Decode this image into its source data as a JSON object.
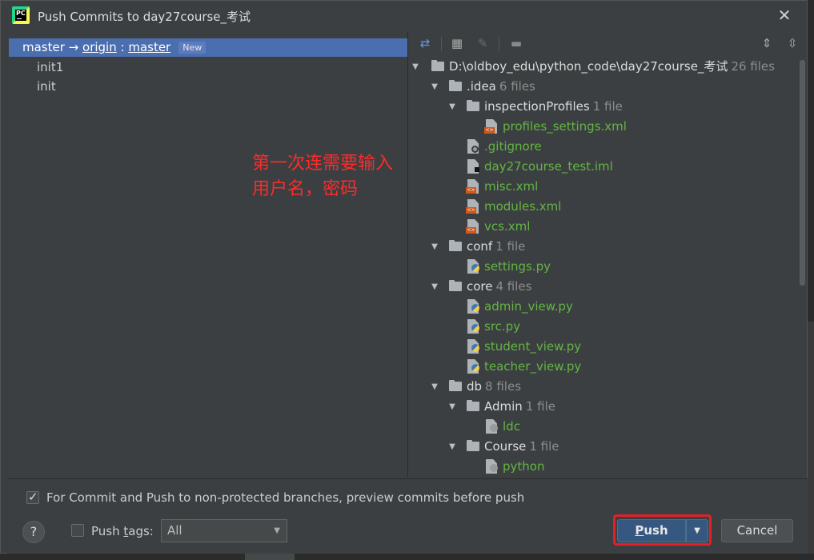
{
  "window": {
    "title": "Push Commits to day27course_考试",
    "app_icon": "pycharm-icon",
    "close_icon": "✕"
  },
  "left": {
    "branch": {
      "local": "master",
      "arrow": " → ",
      "remote": "origin",
      "sep": " : ",
      "remote_branch": "master",
      "badge": "New"
    },
    "commits": [
      "init1",
      "init"
    ]
  },
  "annotation": {
    "line1": "第一次连需要输入",
    "line2": "用户名，密码",
    "color": "#ff2a2a"
  },
  "tree": {
    "root": {
      "name": "D:\\oldboy_edu\\python_code\\day27course_考试",
      "count": "26 files"
    },
    "idea": {
      "name": ".idea",
      "count": "6 files"
    },
    "inspection": {
      "name": "inspectionProfiles",
      "count": "1 file"
    },
    "profiles": {
      "name": "profiles_settings.xml"
    },
    "gitignore": {
      "name": ".gitignore"
    },
    "iml": {
      "name": "day27course_test.iml"
    },
    "misc": {
      "name": "misc.xml"
    },
    "modules": {
      "name": "modules.xml"
    },
    "vcs": {
      "name": "vcs.xml"
    },
    "conf": {
      "name": "conf",
      "count": "1 file"
    },
    "settings": {
      "name": "settings.py"
    },
    "core": {
      "name": "core",
      "count": "4 files"
    },
    "admin_view": {
      "name": "admin_view.py"
    },
    "src": {
      "name": "src.py"
    },
    "student_view": {
      "name": "student_view.py"
    },
    "teacher_view": {
      "name": "teacher_view.py"
    },
    "db": {
      "name": "db",
      "count": "8 files"
    },
    "admin_dir": {
      "name": "Admin",
      "count": "1 file"
    },
    "ldc": {
      "name": "ldc"
    },
    "course_dir": {
      "name": "Course",
      "count": "1 file"
    },
    "python": {
      "name": "python"
    }
  },
  "bottom": {
    "preview_label": "For Commit and Push to non-protected branches, preview commits before push",
    "preview_checked": true,
    "push_tags_label_pre": "Push ",
    "push_tags_label_u": "t",
    "push_tags_label_post": "ags:",
    "push_tags_checked": false,
    "tags_value": "All",
    "help": "?",
    "push_u": "P",
    "push_rest": "ush",
    "cancel": "Cancel"
  },
  "colors": {
    "selection": "#4b6eaf",
    "file_added": "#62b543",
    "push_button": "#365880",
    "highlight_box": "#e0202a"
  }
}
